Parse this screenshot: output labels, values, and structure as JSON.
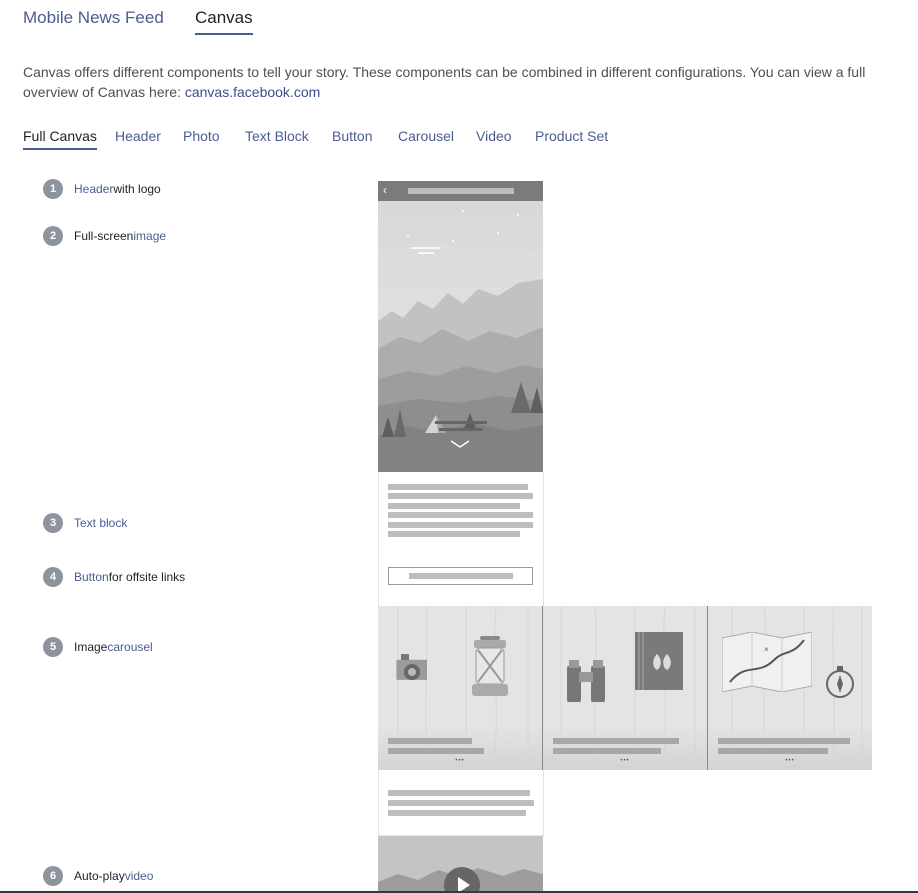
{
  "top_tabs": [
    {
      "label": "Mobile News Feed",
      "active": false
    },
    {
      "label": "Canvas",
      "active": true
    }
  ],
  "intro": {
    "text": "Canvas offers different components to tell your story. These components can be combined in different configurations. You can view a full overview of Canvas here: ",
    "link": "canvas.facebook.com"
  },
  "component_tabs": [
    {
      "label": "Full Canvas",
      "active": true
    },
    {
      "label": "Header"
    },
    {
      "label": "Photo"
    },
    {
      "label": "Text Block"
    },
    {
      "label": "Button"
    },
    {
      "label": "Carousel"
    },
    {
      "label": "Video"
    },
    {
      "label": "Product Set"
    }
  ],
  "features": [
    {
      "num": "1",
      "link": "Header",
      "rest": " with logo"
    },
    {
      "num": "2",
      "pre": "Full-screen ",
      "link": "image"
    },
    {
      "num": "3",
      "link": "Text block"
    },
    {
      "num": "4",
      "link": "Button",
      "rest": " for offsite links"
    },
    {
      "num": "5",
      "pre": "Image ",
      "link": "carousel"
    },
    {
      "num": "6",
      "pre": "Auto-play ",
      "link": "video"
    }
  ],
  "mock": {
    "back_glyph": "‹",
    "carousel_dots": [
      "•••",
      "•••",
      "•••"
    ],
    "colors": {
      "header": "#7b7b7b",
      "placeholder": "#bdbdbd",
      "card": "#e4e4e4"
    }
  }
}
